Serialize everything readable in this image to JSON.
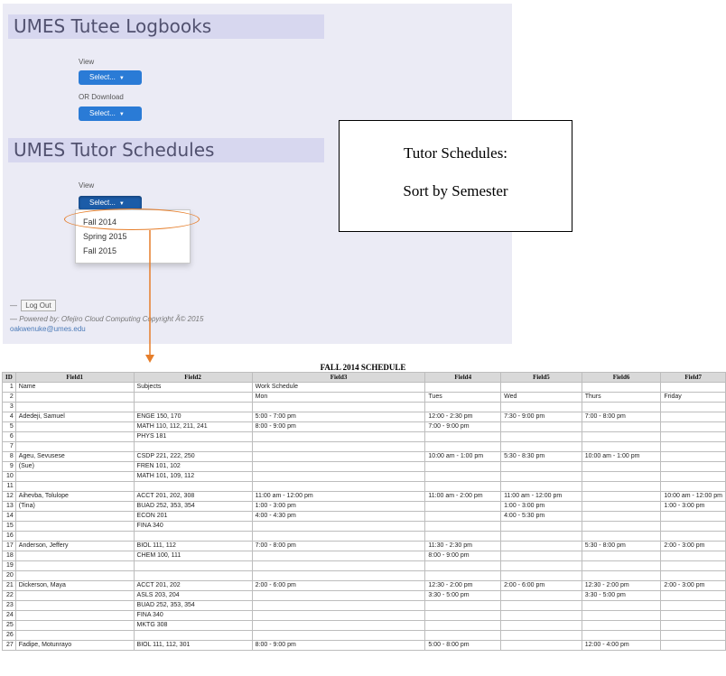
{
  "logbooks": {
    "title": "UMES Tutee Logbooks",
    "view_label": "View",
    "view_button": "Select...",
    "download_label": "OR Download",
    "download_button": "Select..."
  },
  "schedules": {
    "title": "UMES Tutor Schedules",
    "view_label": "View",
    "view_button": "Select...",
    "options": [
      "Fall 2014",
      "Spring 2015",
      "Fall 2015"
    ]
  },
  "footer": {
    "dash1": "—",
    "logout": "Log Out",
    "powered": "— Powered by: Ofejiro Cloud Computing Copyright Ã© 2015",
    "email": "oakwenuke@umes.edu"
  },
  "callout": {
    "line1": "Tutor Schedules:",
    "line2": "Sort by Semester"
  },
  "colors": {
    "accent": "#2a7bd6",
    "annotation": "#e67e2b"
  },
  "sheet": {
    "title": "FALL 2014 SCHEDULE",
    "headers": [
      "ID",
      "Field1",
      "Field2",
      "Field3",
      "Field4",
      "Field5",
      "Field6",
      "Field7"
    ],
    "rows": [
      [
        "1",
        "Name",
        "Subjects",
        "Work Schedule",
        "",
        "",
        "",
        ""
      ],
      [
        "2",
        "",
        "",
        "Mon",
        "Tues",
        "Wed",
        "Thurs",
        "Friday"
      ],
      [
        "3",
        "",
        "",
        "",
        "",
        "",
        "",
        ""
      ],
      [
        "4",
        "Adedeji, Samuel",
        "ENGE 150, 170",
        "5:00 - 7:00 pm",
        "12:00 - 2:30 pm",
        "7:30 - 9:00 pm",
        "7:00 - 8:00 pm",
        ""
      ],
      [
        "5",
        "",
        "MATH 110, 112, 211, 241",
        "8:00 - 9:00 pm",
        "7:00 - 9:00 pm",
        "",
        "",
        ""
      ],
      [
        "6",
        "",
        "PHYS 181",
        "",
        "",
        "",
        "",
        ""
      ],
      [
        "7",
        "",
        "",
        "",
        "",
        "",
        "",
        ""
      ],
      [
        "8",
        "Ageu, Sevusese",
        "CSDP 221, 222, 250",
        "",
        "10:00 am - 1:00 pm",
        "5:30 - 8:30 pm",
        "10:00 am - 1:00 pm",
        ""
      ],
      [
        "9",
        "(Sue)",
        "FREN 101, 102",
        "",
        "",
        "",
        "",
        ""
      ],
      [
        "10",
        "",
        "MATH 101, 109, 112",
        "",
        "",
        "",
        "",
        ""
      ],
      [
        "11",
        "",
        "",
        "",
        "",
        "",
        "",
        ""
      ],
      [
        "12",
        "Aihevba, Tolulope",
        "ACCT 201, 202, 308",
        "11:00 am - 12:00 pm",
        "11:00 am - 2:00 pm",
        "11:00 am - 12:00 pm",
        "",
        "10:00 am - 12:00 pm"
      ],
      [
        "13",
        "(Tina)",
        "BUAD 252, 353, 354",
        "1:00 - 3:00 pm",
        "",
        "1:00 - 3:00 pm",
        "",
        "1:00 - 3:00 pm"
      ],
      [
        "14",
        "",
        "ECON 201",
        "4:00 - 4:30 pm",
        "",
        "4:00 - 5:30 pm",
        "",
        ""
      ],
      [
        "15",
        "",
        "FINA 340",
        "",
        "",
        "",
        "",
        ""
      ],
      [
        "16",
        "",
        "",
        "",
        "",
        "",
        "",
        ""
      ],
      [
        "17",
        "Anderson, Jeffery",
        "BIOL 111, 112",
        "7:00 - 8:00 pm",
        "11:30 - 2:30 pm",
        "",
        "5:30 - 8:00 pm",
        "2:00 - 3:00 pm"
      ],
      [
        "18",
        "",
        "CHEM 100, 111",
        "",
        "8:00 - 9:00 pm",
        "",
        "",
        ""
      ],
      [
        "19",
        "",
        "",
        "",
        "",
        "",
        "",
        ""
      ],
      [
        "20",
        "",
        "",
        "",
        "",
        "",
        "",
        ""
      ],
      [
        "21",
        "Dickerson, Maya",
        "ACCT 201, 202",
        "2:00 - 6:00 pm",
        "12:30 - 2:00 pm",
        "2:00 - 6:00 pm",
        "12:30 - 2:00 pm",
        "2:00 - 3:00 pm"
      ],
      [
        "22",
        "",
        "ASLS 203, 204",
        "",
        "3:30 - 5:00 pm",
        "",
        "3:30 - 5:00 pm",
        ""
      ],
      [
        "23",
        "",
        "BUAD 252, 353, 354",
        "",
        "",
        "",
        "",
        ""
      ],
      [
        "24",
        "",
        "FINA 340",
        "",
        "",
        "",
        "",
        ""
      ],
      [
        "25",
        "",
        "MKTG 308",
        "",
        "",
        "",
        "",
        ""
      ],
      [
        "26",
        "",
        "",
        "",
        "",
        "",
        "",
        ""
      ],
      [
        "27",
        "Fadipe, Motunrayo",
        "BIOL 111, 112, 301",
        "8:00 - 9:00 pm",
        "5:00 - 8:00 pm",
        "",
        "12:00 - 4:00 pm",
        ""
      ]
    ]
  }
}
